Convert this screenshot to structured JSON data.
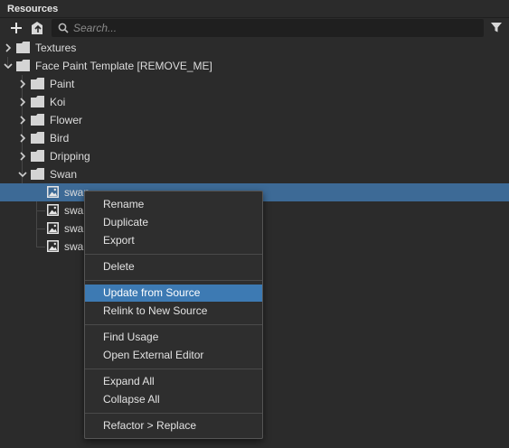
{
  "panel": {
    "title": "Resources"
  },
  "toolbar": {
    "add_icon": "plus-icon",
    "import_icon": "import-icon",
    "search_placeholder": "Search...",
    "filter_icon": "filter-icon"
  },
  "tree": {
    "items": [
      {
        "label": "Textures",
        "level": 0,
        "expanded": false
      },
      {
        "label": "Face Paint Template [REMOVE_ME]",
        "level": 0,
        "expanded": true
      },
      {
        "label": "Paint",
        "level": 1,
        "expanded": false
      },
      {
        "label": "Koi",
        "level": 1,
        "expanded": false
      },
      {
        "label": "Flower",
        "level": 1,
        "expanded": false
      },
      {
        "label": "Bird",
        "level": 1,
        "expanded": false
      },
      {
        "label": "Dripping",
        "level": 1,
        "expanded": false
      },
      {
        "label": "Swan",
        "level": 1,
        "expanded": true
      },
      {
        "label": "swan",
        "level": 2,
        "type": "image",
        "selected": true
      },
      {
        "label": "swan",
        "level": 2,
        "type": "image"
      },
      {
        "label": "swan",
        "level": 2,
        "type": "image"
      },
      {
        "label": "swan",
        "level": 2,
        "type": "image"
      }
    ]
  },
  "context_menu": {
    "groups": [
      [
        "Rename",
        "Duplicate",
        "Export"
      ],
      [
        "Delete"
      ],
      [
        "Update from Source",
        "Relink to New Source"
      ],
      [
        "Find Usage",
        "Open External Editor"
      ],
      [
        "Expand All",
        "Collapse All"
      ],
      [
        "Refactor > Replace"
      ]
    ],
    "highlighted": "Update from Source"
  },
  "colors": {
    "background": "#2b2b2b",
    "selection": "#3d6a96",
    "menu_highlight": "#3d7ab3"
  }
}
